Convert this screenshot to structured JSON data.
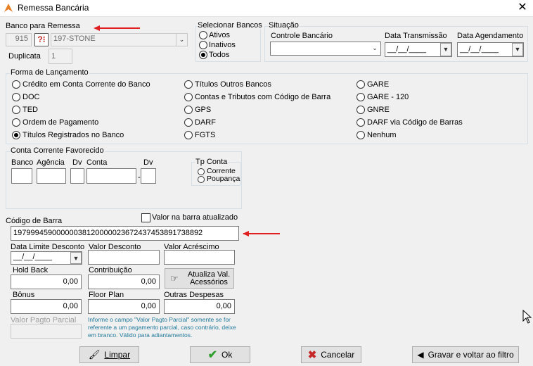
{
  "window": {
    "title": "Remessa Bancária"
  },
  "banco": {
    "label": "Banco para Remessa",
    "code": "915",
    "name": "197-STONE",
    "duplicata_label": "Duplicata",
    "duplicata": "1",
    "help_icon": "help-question-icon"
  },
  "selecionar": {
    "label": "Selecionar Bancos",
    "options": [
      "Ativos",
      "Inativos",
      "Todos"
    ],
    "selected": "Todos"
  },
  "situacao": {
    "label": "Situação",
    "controle_label": "Controle Bancário",
    "transmissao_label": "Data Transmissão",
    "transmissao_value": "__/__/____",
    "agendamento_label": "Data Agendamento",
    "agendamento_value": "__/__/____"
  },
  "forma": {
    "label": "Forma de Lançamento",
    "col1": [
      "Crédito em Conta Corrente do Banco",
      "DOC",
      "TED",
      "Ordem de Pagamento",
      "Títulos Registrados no Banco"
    ],
    "col2": [
      "Títulos Outros Bancos",
      "Contas e Tributos com Código de Barra",
      "GPS",
      "DARF",
      "FGTS"
    ],
    "col3": [
      "GARE",
      "GARE - 120",
      "GNRE",
      "DARF via Código de Barras",
      "Nenhum"
    ],
    "selected": "Títulos Registrados no Banco"
  },
  "conta": {
    "label": "Conta Corrente Favorecido",
    "banco": "Banco",
    "agencia": "Agência",
    "dv1": "Dv",
    "conta": "Conta",
    "dv2": "Dv",
    "sep": "-",
    "tp_label": "Tp Conta",
    "tp_options": [
      "Corrente",
      "Poupança"
    ]
  },
  "barra": {
    "label": "Código de Barra",
    "value": "19799945900000038120000023672437453891738892",
    "check_label": "Valor na barra atualizado"
  },
  "valores": {
    "data_limite_label": "Data Limite Desconto",
    "data_limite": "__/__/____",
    "valor_desconto_label": "Valor Desconto",
    "valor_acrescimo_label": "Valor Acréscimo",
    "hold_back_label": "Hold Back",
    "hold_back": "0,00",
    "contribuicao_label": "Contribuição",
    "contribuicao": "0,00",
    "atualiza_label_1": "Atualiza Val.",
    "atualiza_label_2": "Acessórios",
    "bonus_label": "Bônus",
    "bonus": "0,00",
    "floor_plan_label": "Floor Plan",
    "floor_plan": "0,00",
    "outras_label": "Outras Despesas",
    "outras": "0,00",
    "parcial_label": "Valor Pagto Parcial",
    "hint": "Informe o campo \"Valor Pagto Parcial\" somente se for referente a um pagamento parcial, caso contrário, deixe em branco. Válido para adiantamentos."
  },
  "buttons": {
    "limpar": "Limpar",
    "ok": "Ok",
    "cancelar": "Cancelar",
    "gravar": "Gravar e voltar ao filtro"
  },
  "colors": {
    "accent_arrow": "#e02020",
    "hint": "#1f7a9a",
    "ok_check": "#2e9e2e",
    "cancel_x": "#c62828"
  }
}
